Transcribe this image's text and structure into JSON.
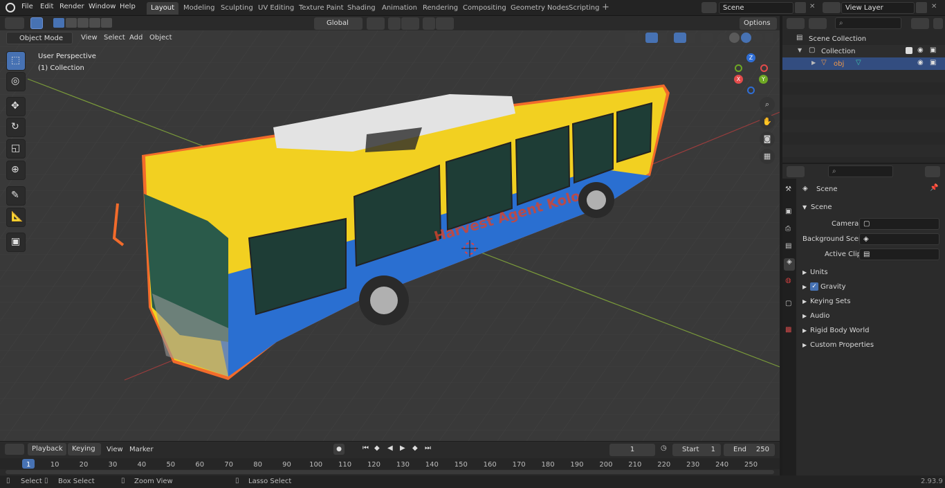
{
  "menus": [
    "File",
    "Edit",
    "Render",
    "Window",
    "Help"
  ],
  "tabs": [
    "Layout",
    "Modeling",
    "Sculpting",
    "UV Editing",
    "Texture Paint",
    "Shading",
    "Animation",
    "Rendering",
    "Compositing",
    "Geometry Nodes",
    "Scripting"
  ],
  "scene_name": "Scene",
  "view_layer": "View Layer",
  "viewport_header": {
    "mode": "Object Mode",
    "menu": [
      "View",
      "Select",
      "Add",
      "Object"
    ],
    "orientation": "Global",
    "options": "Options"
  },
  "viewport": {
    "perspective": "User Perspective",
    "collection": "(1) Collection",
    "gizmo": {
      "x": "X",
      "y": "Y",
      "z": "Z"
    }
  },
  "outliner": {
    "scene_collection": "Scene Collection",
    "collection": "Collection",
    "object": "obj"
  },
  "properties": {
    "header": "Scene",
    "panel": "Scene",
    "camera_label": "Camera",
    "background_scene_label": "Background Scene",
    "active_clip_label": "Active Clip",
    "sections": [
      "Units",
      "Gravity",
      "Keying Sets",
      "Audio",
      "Rigid Body World",
      "Custom Properties"
    ]
  },
  "timeline": {
    "menus": [
      "Playback",
      "Keying",
      "View",
      "Marker"
    ],
    "current_frame": "1",
    "start_label": "Start",
    "start": "1",
    "end_label": "End",
    "end": "250",
    "ticks": [
      "1",
      "10",
      "20",
      "30",
      "40",
      "50",
      "60",
      "70",
      "80",
      "90",
      "100",
      "110",
      "120",
      "130",
      "140",
      "150",
      "160",
      "170",
      "180",
      "190",
      "200",
      "210",
      "220",
      "230",
      "240",
      "250"
    ]
  },
  "status": {
    "select": "Select",
    "box_select": "Box Select",
    "zoom_view": "Zoom View",
    "lasso_select": "Lasso Select",
    "version": "2.93.9"
  },
  "bus_text": "Harvest Agent Koloda",
  "colors": {
    "accent": "#4772b3",
    "selection": "#f26b2b",
    "bus_yellow": "#f2d021",
    "bus_blue": "#2a6fd1"
  }
}
